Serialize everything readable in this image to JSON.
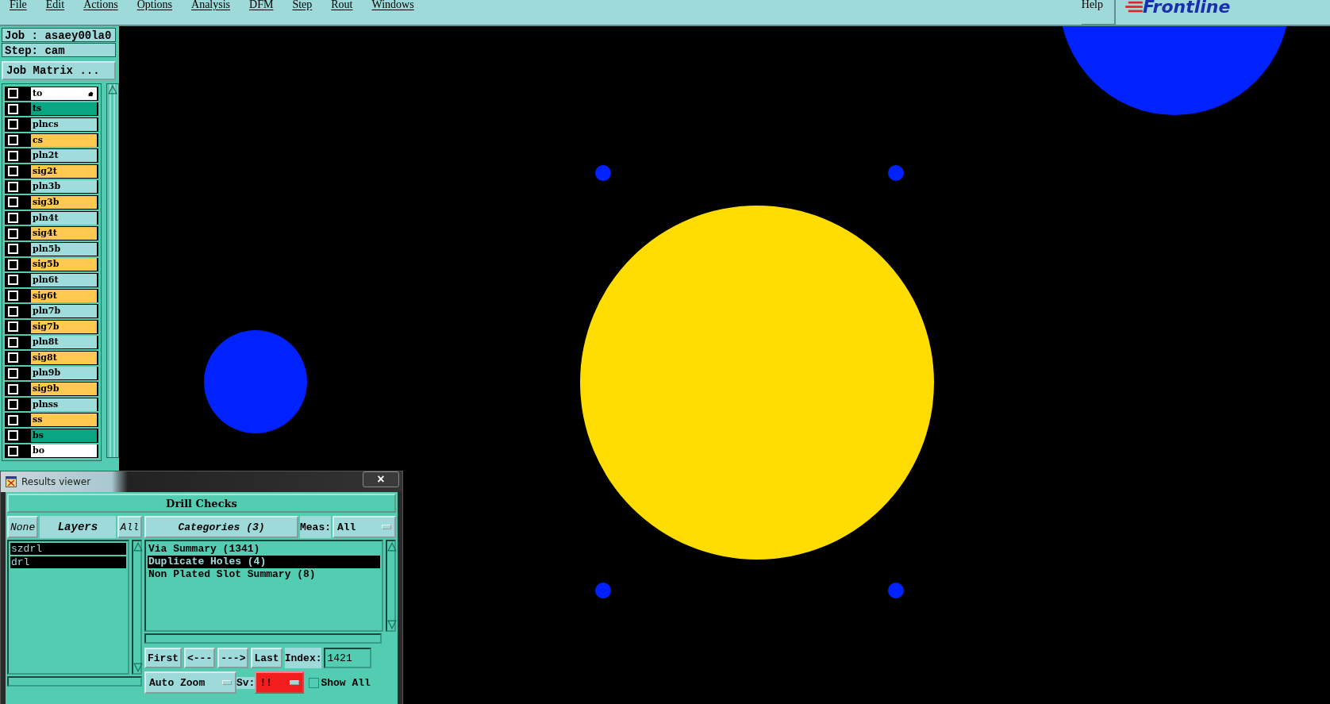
{
  "menu": [
    {
      "label": "File"
    },
    {
      "label": "Edit"
    },
    {
      "label": "Actions"
    },
    {
      "label": "Options"
    },
    {
      "label": "Analysis"
    },
    {
      "label": "DFM"
    },
    {
      "label": "Step"
    },
    {
      "label": "Rout"
    },
    {
      "label": "Windows"
    }
  ],
  "help": "Help",
  "logo": "Frontline",
  "job": "Job : asaey00la0",
  "step": "Step: cam",
  "job_matrix": "Job Matrix ...",
  "layers": [
    {
      "name": "to",
      "color": "#ffffff",
      "checked": false,
      "active": true
    },
    {
      "name": "ts",
      "color": "#0aa582",
      "checked": false,
      "active": false
    },
    {
      "name": "plncs",
      "color": "#9fdcdc",
      "checked": false,
      "active": false
    },
    {
      "name": "cs",
      "color": "#ffc850",
      "checked": false,
      "active": false
    },
    {
      "name": "pln2t",
      "color": "#9fdcdc",
      "checked": false,
      "active": false
    },
    {
      "name": "sig2t",
      "color": "#ffc850",
      "checked": false,
      "active": false
    },
    {
      "name": "pln3b",
      "color": "#9fdcdc",
      "checked": false,
      "active": false
    },
    {
      "name": "sig3b",
      "color": "#ffc850",
      "checked": false,
      "active": false
    },
    {
      "name": "pln4t",
      "color": "#9fdcdc",
      "checked": false,
      "active": false
    },
    {
      "name": "sig4t",
      "color": "#ffc850",
      "checked": false,
      "active": false
    },
    {
      "name": "pln5b",
      "color": "#9fdcdc",
      "checked": false,
      "active": false
    },
    {
      "name": "sig5b",
      "color": "#ffc850",
      "checked": false,
      "active": false
    },
    {
      "name": "pln6t",
      "color": "#9fdcdc",
      "checked": false,
      "active": false
    },
    {
      "name": "sig6t",
      "color": "#ffc850",
      "checked": false,
      "active": false
    },
    {
      "name": "pln7b",
      "color": "#9fdcdc",
      "checked": false,
      "active": false
    },
    {
      "name": "sig7b",
      "color": "#ffc850",
      "checked": false,
      "active": false
    },
    {
      "name": "pln8t",
      "color": "#9fdcdc",
      "checked": false,
      "active": false
    },
    {
      "name": "sig8t",
      "color": "#ffc850",
      "checked": false,
      "active": false
    },
    {
      "name": "pln9b",
      "color": "#9fdcdc",
      "checked": false,
      "active": false
    },
    {
      "name": "sig9b",
      "color": "#ffc850",
      "checked": false,
      "active": false
    },
    {
      "name": "plnss",
      "color": "#9fdcdc",
      "checked": false,
      "active": false
    },
    {
      "name": "ss",
      "color": "#ffc850",
      "checked": false,
      "active": false
    },
    {
      "name": "bs",
      "color": "#0aa582",
      "checked": false,
      "active": false
    },
    {
      "name": "bo",
      "color": "#ffffff",
      "checked": false,
      "active": false
    }
  ],
  "results_viewer": {
    "title": "Results viewer",
    "close": "×",
    "header": "Drill Checks",
    "filters": [
      {
        "label": "None",
        "kind": "button"
      },
      {
        "label": "Layers",
        "kind": "label"
      },
      {
        "label": "All",
        "kind": "button"
      }
    ],
    "result_layers": [
      {
        "name": "szdrl",
        "selected": true
      },
      {
        "name": "drl",
        "selected": true
      }
    ],
    "categories_title": "Categories (3)",
    "meas_label": "Meas:",
    "meas_value": "All",
    "categories": [
      {
        "name": "Via Summary (1341)",
        "selected": false
      },
      {
        "name": "Duplicate Holes (4)",
        "selected": true
      },
      {
        "name": "Non Plated Slot Summary (8)",
        "selected": false
      }
    ],
    "nav": [
      "First",
      "<---",
      "--->",
      "Last"
    ],
    "index_label": "Index:",
    "index_value": "1421",
    "zoom_mode": "Auto Zoom",
    "sv_label": "Sv:",
    "sv_value": "!!",
    "show_all": {
      "label": "Show All",
      "checked": false
    }
  }
}
